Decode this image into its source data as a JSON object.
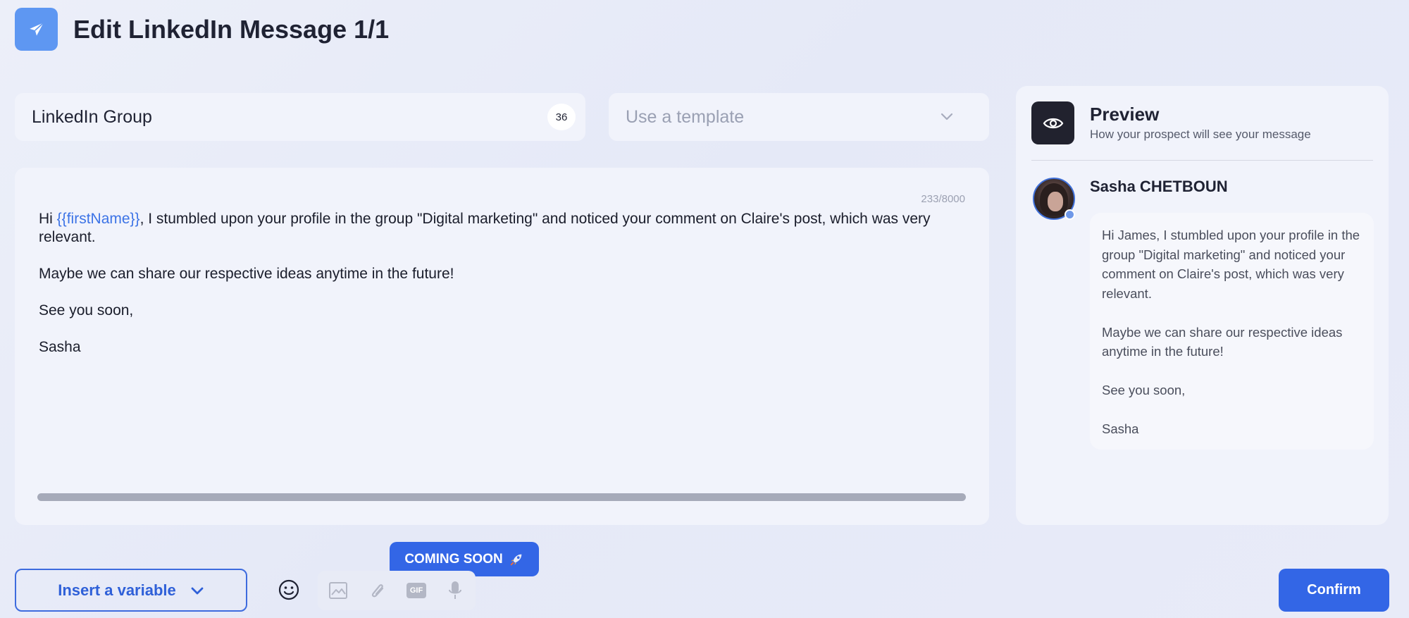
{
  "header": {
    "title": "Edit LinkedIn Message 1/1",
    "logo_icon": "paper-plane-icon"
  },
  "group_field": {
    "value": "LinkedIn Group",
    "count": "36"
  },
  "template_select": {
    "placeholder": "Use a template",
    "icon": "chevron-down-icon"
  },
  "editor": {
    "char_count": "233/8000",
    "greeting_prefix": "Hi ",
    "variable": "{{firstName}}",
    "line1_rest": ", I stumbled upon your profile in the group \"Digital marketing\" and noticed your comment on Claire's post, which was very relevant.",
    "line2": "Maybe we can share our respective ideas anytime in the future!",
    "line3": "See you soon,",
    "line4": "Sasha"
  },
  "preview": {
    "title": "Preview",
    "subtitle": "How your prospect will see your message",
    "sender_name": "Sasha CHETBOUN",
    "message": {
      "p1": "Hi James, I stumbled upon your profile in the group \"Digital marketing\" and noticed your comment on Claire's post, which was very relevant.",
      "p2": "Maybe we can share our respective ideas anytime in the future!",
      "p3": "See you soon,",
      "p4": "Sasha"
    }
  },
  "toolbar": {
    "insert_variable_label": "Insert a variable",
    "coming_soon_label": "COMING SOON",
    "coming_soon_icon": "rocket-icon",
    "gif_label": "GIF",
    "confirm_label": "Confirm"
  },
  "colors": {
    "accent": "#3366e6",
    "variable": "#3c73e6",
    "logo_bg": "#5e97f2",
    "dark_icon_bg": "#21222e"
  }
}
